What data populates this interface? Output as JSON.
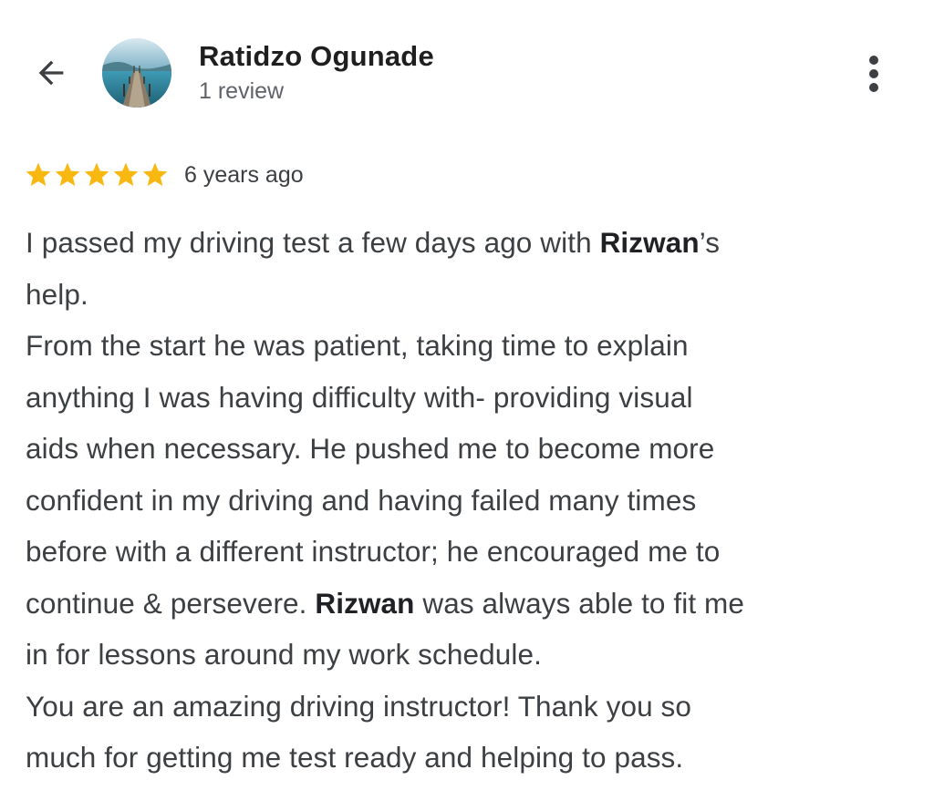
{
  "header": {
    "back_icon": "arrow-back-icon",
    "avatar_icon": "avatar-photo-pier-lake",
    "reviewer_name": "Ratidzo Ogunade",
    "review_count": "1 review",
    "more_icon": "more-vert-icon"
  },
  "review": {
    "rating": 5,
    "max_rating": 5,
    "star_color": "#F9B811",
    "time_ago": "6 years ago",
    "lines": [
      {
        "parts": [
          {
            "text": "I passed my driving test a few days ago with ",
            "bold": false
          },
          {
            "text": "Rizwan",
            "bold": true
          },
          {
            "text": "’s",
            "bold": false
          }
        ]
      },
      {
        "parts": [
          {
            "text": "help.",
            "bold": false
          }
        ]
      },
      {
        "parts": [
          {
            "text": "From the start he was patient, taking time to explain",
            "bold": false
          }
        ]
      },
      {
        "parts": [
          {
            "text": "anything I was having difficulty with- providing visual",
            "bold": false
          }
        ]
      },
      {
        "parts": [
          {
            "text": "aids when necessary. He pushed me to become more",
            "bold": false
          }
        ]
      },
      {
        "parts": [
          {
            "text": "confident in my driving and having failed many times",
            "bold": false
          }
        ]
      },
      {
        "parts": [
          {
            "text": "before with a different instructor; he encouraged me to",
            "bold": false
          }
        ]
      },
      {
        "parts": [
          {
            "text": "continue & persevere. ",
            "bold": false
          },
          {
            "text": "Rizwan",
            "bold": true
          },
          {
            "text": " was always able to fit me",
            "bold": false
          }
        ]
      },
      {
        "parts": [
          {
            "text": "in for lessons around my work schedule.",
            "bold": false
          }
        ]
      },
      {
        "parts": [
          {
            "text": "You are an amazing driving instructor! Thank you so",
            "bold": false
          }
        ]
      },
      {
        "parts": [
          {
            "text": "much for getting me test ready and helping to pass.",
            "bold": false
          }
        ]
      }
    ]
  }
}
